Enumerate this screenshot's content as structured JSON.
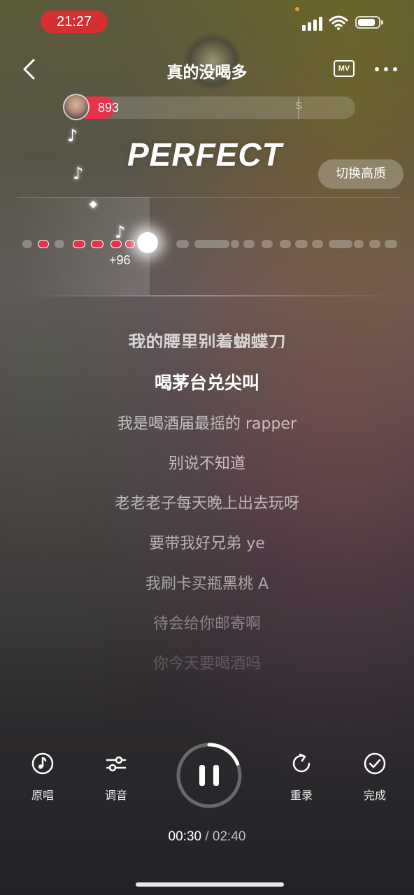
{
  "status_bar": {
    "time": "21:27",
    "battery_level": 0.85
  },
  "header": {
    "title": "真的没喝多",
    "mv_label": "MV"
  },
  "score": {
    "value": "893",
    "rank_mark": "S",
    "progress": 0.14
  },
  "feedback": {
    "text": "PERFECT",
    "bonus": "+96"
  },
  "quality_button": {
    "label": "切换高质"
  },
  "lyrics": [
    "我的腰里别着蝴蝶刀",
    "喝茅台兑尖叫",
    "我是喝酒届最摇的 rapper",
    "别说不知道",
    "老老老子每天晚上出去玩呀",
    "要带我好兄弟 ye",
    "我刷卡买瓶黑桃 A",
    "待会给你邮寄啊",
    "你今天要喝酒吗"
  ],
  "controls": {
    "original_label": "原唱",
    "tune_label": "调音",
    "rerecord_label": "重录",
    "done_label": "完成"
  },
  "playback": {
    "current": "00:30",
    "separator": "/",
    "total": "02:40",
    "progress": 0.1875
  }
}
